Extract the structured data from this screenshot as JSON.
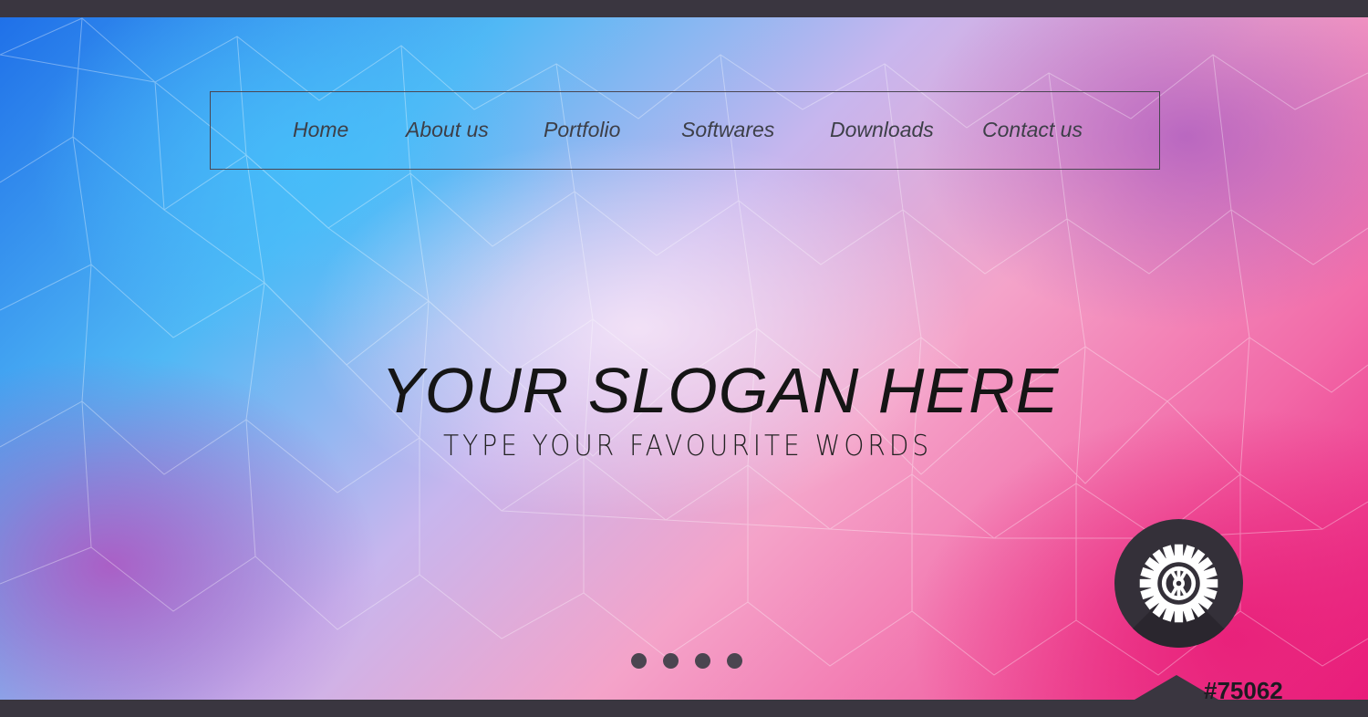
{
  "nav": {
    "items": [
      {
        "label": "Home"
      },
      {
        "label": "About us"
      },
      {
        "label": "Portfolio"
      },
      {
        "label": "Softwares"
      },
      {
        "label": "Downloads"
      },
      {
        "label": "Contact us"
      }
    ]
  },
  "hero": {
    "slogan": "YOUR SLOGAN HERE",
    "subline": "TYPE YOUR FAVOURITE WORDS"
  },
  "slider": {
    "dot_count": 4
  },
  "settings": {
    "icon": "gear-icon"
  },
  "stock_id": "#75062",
  "colors": {
    "bars": "#3a3640",
    "text": "#151515",
    "gear_circle": "#343039",
    "gear": "#ffffff"
  }
}
